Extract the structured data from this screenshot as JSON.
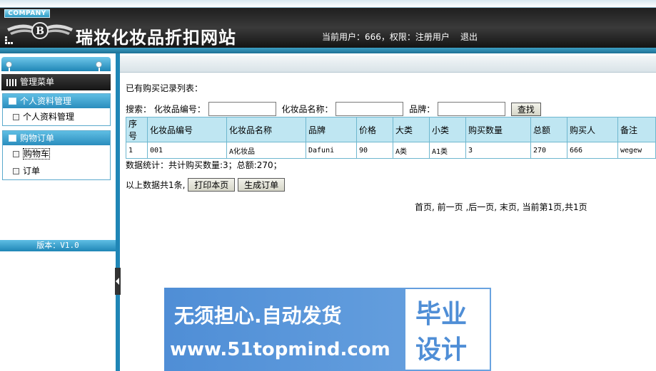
{
  "header": {
    "company": "COMPANY",
    "site_title": "瑞妆化妆品折扣网站",
    "user_info": "当前用户：666，权限：注册用户",
    "logout": "退出"
  },
  "sidebar": {
    "menu_title": "管理菜单",
    "groups": [
      {
        "title": "个人资料管理",
        "items": [
          "个人资料管理"
        ]
      },
      {
        "title": "购物订单",
        "items": [
          "购物车",
          "订单"
        ]
      }
    ],
    "version": "版本：V1.0"
  },
  "content": {
    "list_title": "已有购买记录列表：",
    "search": {
      "label": "搜索：",
      "code_label": "化妆品编号：",
      "name_label": "化妆品名称：",
      "brand_label": "品牌：",
      "code_value": "",
      "name_value": "",
      "brand_value": "",
      "button": "查找"
    },
    "table": {
      "headers": [
        "序号",
        "化妆品编号",
        "化妆品名称",
        "品牌",
        "价格",
        "大类",
        "小类",
        "购买数量",
        "总额",
        "购买人",
        "备注"
      ],
      "rows": [
        [
          "1",
          "001",
          "A化妆品",
          "Dafuni",
          "90",
          "A类",
          "A1类",
          "3",
          "270",
          "666",
          "wegew"
        ]
      ]
    },
    "stats": "数据统计：共计购买数量:3；总额:270；",
    "total_text": "以上数据共1条,",
    "print_button": "打印本页",
    "order_button": "生成订单",
    "pager": "首页, 前一页 ,后一页, 末页, 当前第1页,共1页"
  },
  "watermark": {
    "line1": "无须担心.自动发货",
    "line2": "www.51topmind.com",
    "box_line1": "毕业",
    "box_line2": "设计"
  },
  "colors": {
    "accent_blue": "#1f86b6",
    "table_header": "#bfe6f2",
    "watermark_blue": "#4f8ed6"
  }
}
